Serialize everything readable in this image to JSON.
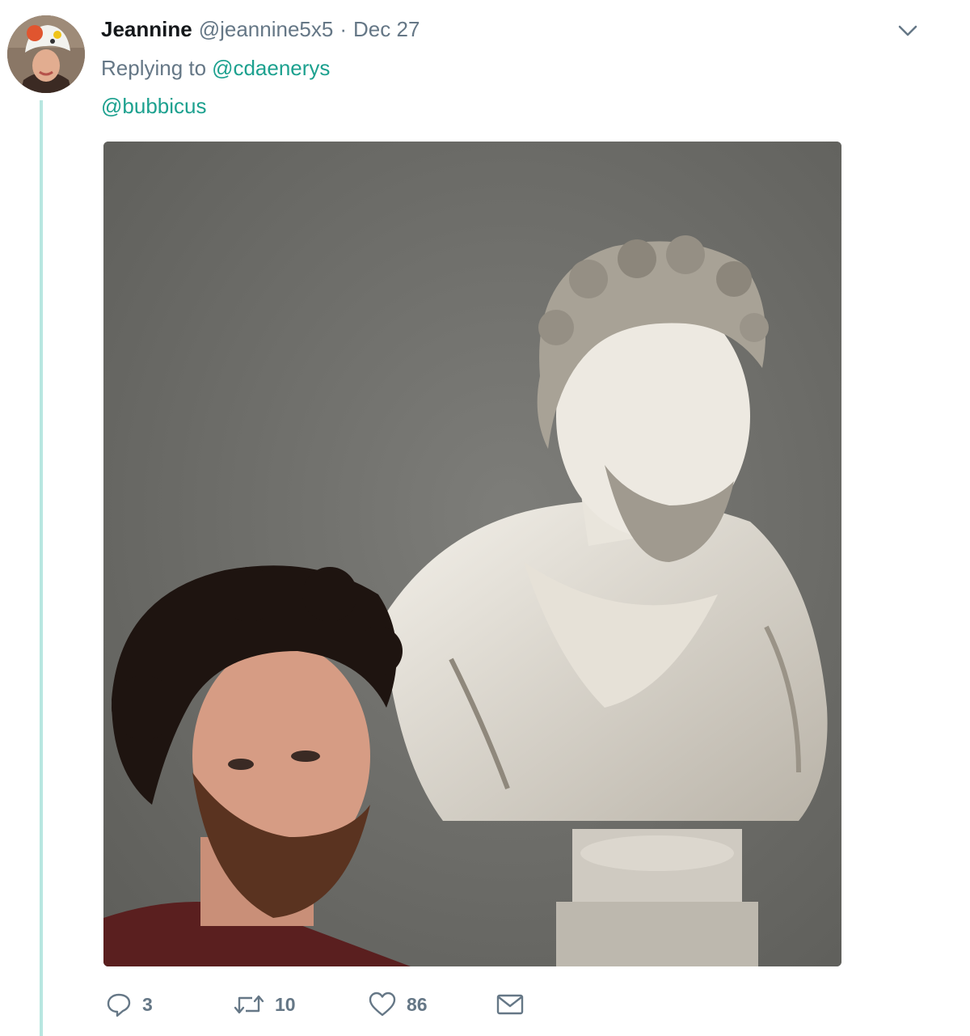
{
  "tweet": {
    "display_name": "Jeannine",
    "handle": "@jeannine5x5",
    "separator": "·",
    "date": "Dec 27",
    "replying_prefix": "Replying to",
    "replying_to": "@cdaenerys",
    "text": "@bubbicus"
  },
  "icons": {
    "caret": "chevron-down-icon",
    "reply": "reply-icon",
    "retweet": "retweet-icon",
    "like": "heart-icon",
    "dm": "envelope-icon"
  },
  "actions": {
    "reply_count": "3",
    "retweet_count": "10",
    "like_count": "86"
  },
  "colors": {
    "link": "#1da18f",
    "secondary_text": "#657786",
    "thread_line": "#b8e6e0"
  }
}
